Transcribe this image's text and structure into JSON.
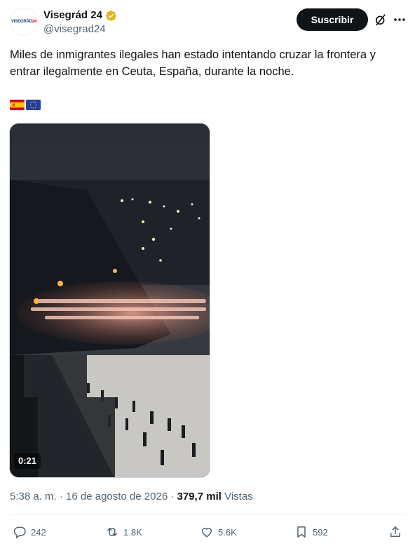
{
  "author": {
    "display_name": "Visegrád 24",
    "handle": "@visegrad24",
    "avatar_text_a": "VISEGRÁD",
    "avatar_text_b": "24",
    "verified": true
  },
  "subscribe_label": "Suscribir",
  "tweet": {
    "text": "Miles de inmigrantes ilegales han estado intentando cruzar la frontera y entrar ilegalmente en Ceuta, España, durante la noche.",
    "flags": [
      "spain-flag",
      "eu-flag"
    ]
  },
  "media": {
    "duration": "0:21"
  },
  "meta": {
    "time": "5:38 a. m.",
    "separator": " · ",
    "date": "16 de agosto de 2026",
    "views_count": "379,7 mil",
    "views_label": "Vistas"
  },
  "actions": {
    "replies": "242",
    "reposts": "1.8K",
    "likes": "5.6K",
    "bookmarks": "592"
  },
  "colors": {
    "text": "#0f1419",
    "secondary": "#536471",
    "verified_gold": "#e2b719",
    "button_bg": "#0f1419"
  }
}
